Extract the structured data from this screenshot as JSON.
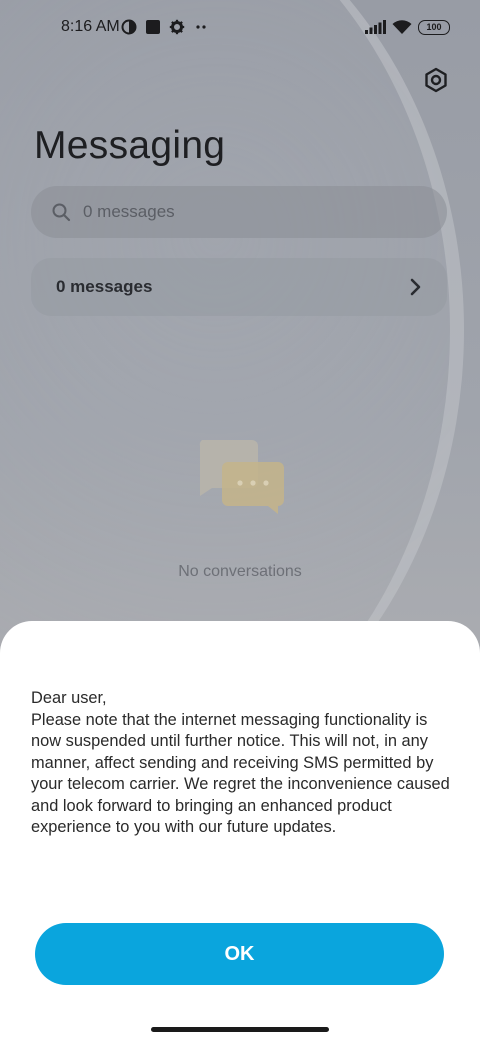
{
  "status_bar": {
    "time": "8:16 AM",
    "battery": "100",
    "icons_left": [
      "data-saver-icon",
      "notification-square-icon",
      "gear-icon",
      "more-dots-icon"
    ],
    "icons_right": [
      "signal-icon",
      "wifi-icon",
      "battery-icon"
    ]
  },
  "header": {
    "title": "Messaging",
    "settings_icon": "settings-hex-icon"
  },
  "search": {
    "placeholder": "0 messages",
    "icon": "search-icon"
  },
  "messages_row": {
    "label": "0 messages",
    "icon": "chevron-right-icon"
  },
  "empty_state": {
    "icon": "chat-bubbles-icon",
    "text": "No conversations"
  },
  "dialog": {
    "message": "Dear user,\nPlease note that the internet messaging functionality is now suspended until further notice. This will not, in any manner, affect sending and receiving SMS permitted by your telecom carrier. We regret the inconvenience caused and look forward to bringing an enhanced product experience to you with our future updates.",
    "ok_label": "OK"
  },
  "colors": {
    "accent": "#0aa5dd",
    "sheet": "#ffffff",
    "text_dark": "#1e1f22"
  }
}
